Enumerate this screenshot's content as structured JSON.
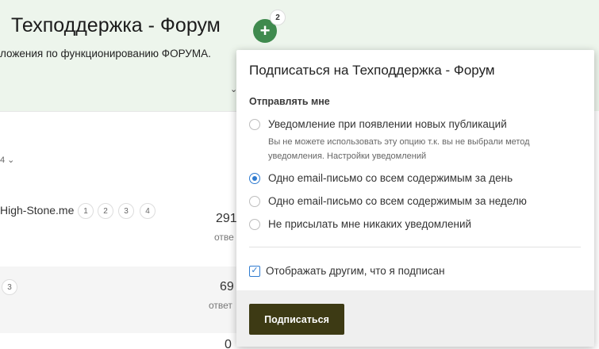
{
  "forum": {
    "title": "Техподдержка - Форум",
    "follow_count": "2",
    "description": "ложения по функционированию ФОРУМА.",
    "sort_chevron": "⌄",
    "sort_toggle": "4 ⌄"
  },
  "rows": [
    {
      "title": "High-Stone.me",
      "pages": [
        "1",
        "2",
        "3",
        "4"
      ],
      "count": "291",
      "count_label": "отве"
    },
    {
      "title": "",
      "pages": [
        "3"
      ],
      "count": "69",
      "count_label": "ответ"
    },
    {
      "title": "",
      "pages": [],
      "count": "0",
      "count_label": ""
    }
  ],
  "popup": {
    "title": "Подписаться на Техподдержка - Форум",
    "send_me_label": "Отправлять мне",
    "options": [
      {
        "label": "Уведомление при появлении новых публикаций",
        "checked": false,
        "disabled": true
      },
      {
        "label": "Одно email-письмо со всем содержимым за день",
        "checked": true,
        "disabled": false
      },
      {
        "label": "Одно email-письмо со всем содержимым за неделю",
        "checked": false,
        "disabled": false
      },
      {
        "label": "Не присылать мне никаких уведомлений",
        "checked": false,
        "disabled": false
      }
    ],
    "option_note": "Вы не можете использовать эту опцию т.к. вы не выбрали метод уведомления. Настройки уведомлений",
    "show_others_label": "Отображать другим, что я подписан",
    "show_others_checked": true,
    "subscribe_label": "Подписаться"
  },
  "colors": {
    "header_band": "#edf5ec",
    "follow_button": "#3f8a4e",
    "radio_accent": "#2f7bd0",
    "subscribe_button": "#3d3a14"
  }
}
